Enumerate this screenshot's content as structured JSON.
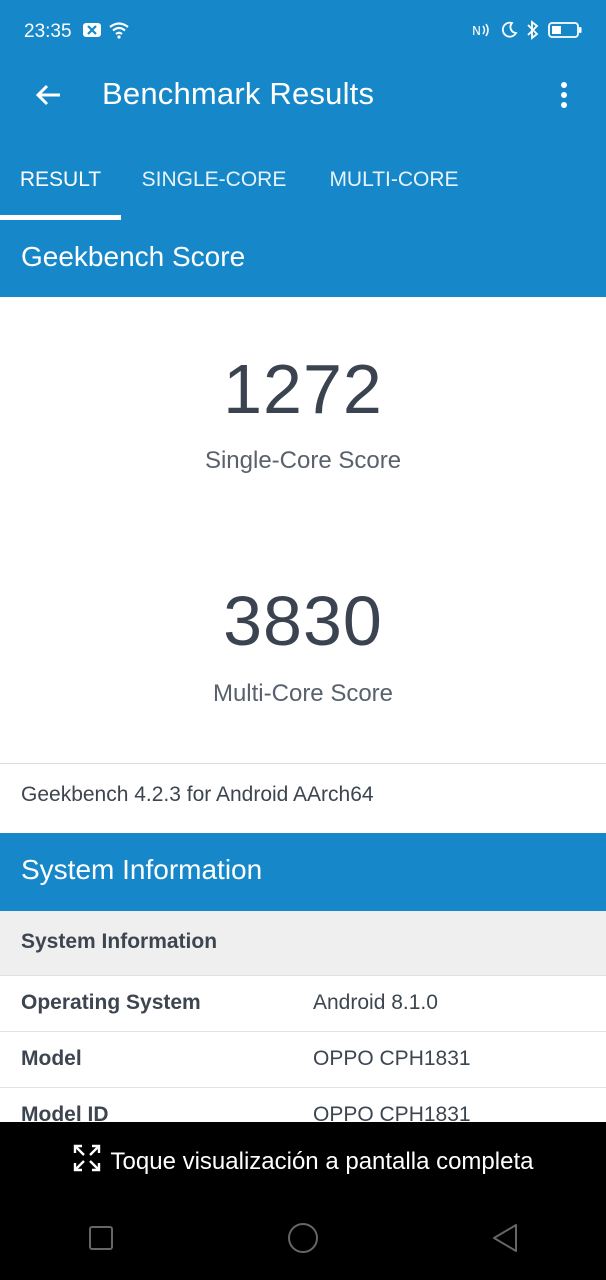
{
  "status_bar": {
    "time": "23:35",
    "icons": [
      "notification-x-icon",
      "wifi-icon",
      "nfc-icon",
      "moon-icon",
      "bluetooth-icon",
      "battery-icon"
    ]
  },
  "app_bar": {
    "title": "Benchmark Results",
    "back_icon": "arrow-left-icon",
    "menu_icon": "more-vertical-icon"
  },
  "tabs": [
    {
      "label": "RESULT",
      "active": true
    },
    {
      "label": "SINGLE-CORE",
      "active": false
    },
    {
      "label": "MULTI-CORE",
      "active": false
    }
  ],
  "geekbench_score": {
    "header": "Geekbench Score",
    "single_core": {
      "value": "1272",
      "label": "Single-Core Score"
    },
    "multi_core": {
      "value": "3830",
      "label": "Multi-Core Score"
    },
    "version": "Geekbench 4.2.3 for Android AArch64"
  },
  "system_information": {
    "header": "System Information",
    "subheader": "System Information",
    "rows": [
      {
        "key": "Operating System",
        "value": "Android 8.1.0"
      },
      {
        "key": "Model",
        "value": "OPPO CPH1831"
      },
      {
        "key": "Model ID",
        "value": "OPPO CPH1831"
      }
    ]
  },
  "overlay": {
    "toast": "Toque visualización a pantalla completa",
    "toast_icon": "fullscreen-icon"
  },
  "nav_bar": {
    "buttons": [
      "recents-square-icon",
      "home-circle-icon",
      "back-triangle-icon"
    ]
  },
  "colors": {
    "primary": "#1688c9",
    "text": "#3d4550",
    "subheader_bg": "#efefef"
  }
}
